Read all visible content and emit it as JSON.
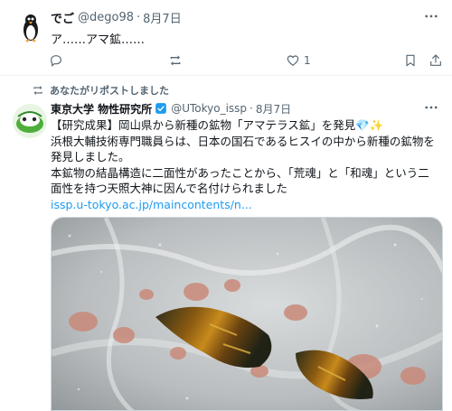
{
  "tweet1": {
    "display_name": "でご",
    "handle": "@dego98",
    "separator": "·",
    "date": "8月7日",
    "text": "ア……アマ鉱……",
    "like_count": "1"
  },
  "tweet2": {
    "retweet_context": "あなたがリポストしました",
    "display_name": "東京大学 物性研究所",
    "handle": "@UTokyo_issp",
    "separator": "·",
    "date": "8月7日",
    "lines": [
      "【研究成果】岡山県から新種の鉱物「アマテラス鉱」を発見💎✨",
      "浜根大輔技術専門職員らは、日本の国石であるヒスイの中から新種の鉱物を",
      "発見しました。",
      "本鉱物の結晶構造に二面性があったことから、「荒魂」と「和魂」という二",
      "面性を持つ天照大神に因んで名付けられました"
    ],
    "link_text": "issp.u-tokyo.ac.jp/maincontents/n..."
  },
  "icons": {
    "reply": "reply-icon",
    "repost": "repost-icon",
    "like": "heart-icon",
    "bookmark": "bookmark-icon",
    "share": "share-icon",
    "more": "more-icon",
    "verified": "verified-badge-icon"
  },
  "colors": {
    "accent": "#1d9bf0",
    "muted": "#536471",
    "divider": "#eff3f4"
  }
}
